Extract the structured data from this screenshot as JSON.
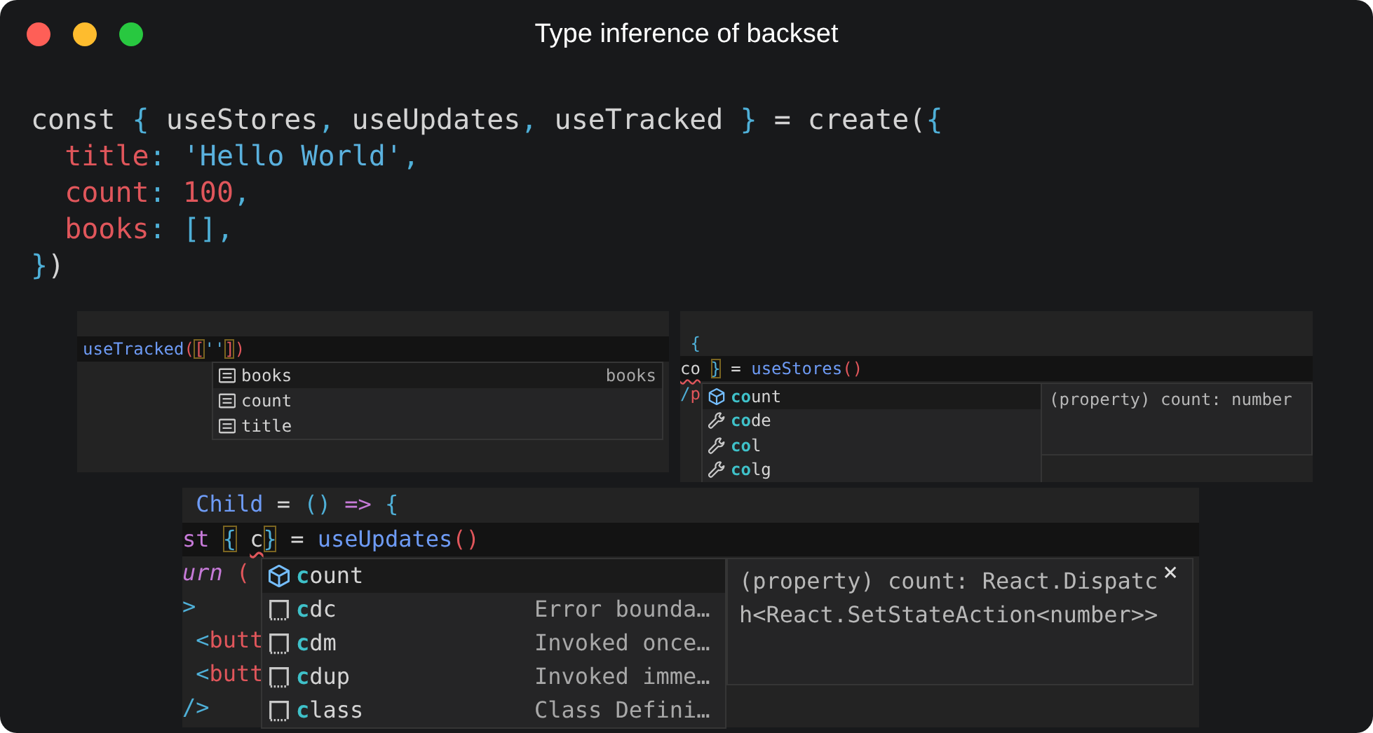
{
  "window": {
    "title": "Type inference of backset"
  },
  "code": {
    "lines": [
      [
        {
          "text": "const ",
          "kind": "plain"
        },
        {
          "text": "{",
          "kind": "brace"
        },
        {
          "text": " useStores",
          "kind": "plain"
        },
        {
          "text": ",",
          "kind": "brace"
        },
        {
          "text": " useUpdates",
          "kind": "plain"
        },
        {
          "text": ",",
          "kind": "brace"
        },
        {
          "text": " useTracked ",
          "kind": "plain"
        },
        {
          "text": "}",
          "kind": "brace"
        },
        {
          "text": " = create(",
          "kind": "plain"
        },
        {
          "text": "{",
          "kind": "brace"
        }
      ],
      [
        {
          "text": "title",
          "kind": "key",
          "indented": true
        },
        {
          "text": ": ",
          "kind": "brace"
        },
        {
          "text": "'Hello World'",
          "kind": "string"
        },
        {
          "text": ",",
          "kind": "brace"
        }
      ],
      [
        {
          "text": "count",
          "kind": "key",
          "indented": true
        },
        {
          "text": ": ",
          "kind": "brace"
        },
        {
          "text": "100",
          "kind": "number"
        },
        {
          "text": ",",
          "kind": "brace"
        }
      ],
      [
        {
          "text": "books",
          "kind": "key",
          "indented": true
        },
        {
          "text": ": ",
          "kind": "brace"
        },
        {
          "text": "[]",
          "kind": "brace"
        },
        {
          "text": ",",
          "kind": "brace"
        }
      ],
      [
        {
          "text": "}",
          "kind": "brace"
        },
        {
          "text": ")",
          "kind": "plain"
        }
      ]
    ]
  },
  "panels": [
    {
      "lines": [
        {
          "current": true,
          "tokens": [
            {
              "text": "useTracked",
              "kind": "func"
            },
            {
              "text": "(",
              "kind": "paren"
            },
            {
              "text": "[",
              "kind": "paren-match"
            },
            {
              "text": "''",
              "kind": "string"
            },
            {
              "text": "]",
              "kind": "paren-match"
            },
            {
              "text": ")",
              "kind": "paren"
            }
          ]
        }
      ],
      "suggestions": [
        {
          "label": "books",
          "kind": "text",
          "selected": true,
          "detail": "books"
        },
        {
          "label": "count",
          "kind": "text",
          "selected": false
        },
        {
          "label": "title",
          "kind": "text",
          "selected": false
        }
      ]
    },
    {
      "lines": [
        {
          "current": false,
          "tokens": [
            {
              "text": " {",
              "kind": "brace"
            }
          ]
        },
        {
          "current": true,
          "tokens": [
            {
              "text": "co",
              "kind": "error"
            },
            {
              "text": "}",
              "kind": "brace-match",
              "spaced": true
            },
            {
              "text": " = ",
              "kind": "plain"
            },
            {
              "text": "useStores",
              "kind": "func"
            },
            {
              "text": "()",
              "kind": "paren"
            }
          ]
        },
        {
          "current": false,
          "tokens": [
            {
              "text": "/",
              "kind": "brace"
            },
            {
              "text": "p",
              "kind": "tag"
            }
          ]
        }
      ],
      "suggestions": [
        {
          "label": "**co**unt",
          "kind": "property",
          "selected": true
        },
        {
          "label": "**co**de",
          "kind": "wrench",
          "selected": false
        },
        {
          "label": "**co**l",
          "kind": "wrench",
          "selected": false
        },
        {
          "label": "**co**lg",
          "kind": "wrench",
          "selected": false
        }
      ],
      "doc": {
        "text": "(property) count: number"
      }
    },
    {
      "lines": [
        {
          "current": false,
          "tokens": [
            {
              "text": " Child",
              "kind": "func"
            },
            {
              "text": " = ",
              "kind": "plain"
            },
            {
              "text": "()",
              "kind": "brace"
            },
            {
              "text": " => ",
              "kind": "keyword"
            },
            {
              "text": "{",
              "kind": "brace"
            }
          ]
        },
        {
          "current": true,
          "tokens": [
            {
              "text": "st",
              "kind": "keyword"
            },
            {
              "text": "{",
              "kind": "brace-match",
              "spaced": true
            },
            {
              "text": "c",
              "kind": "error",
              "spaced": true
            },
            {
              "text": "}",
              "kind": "brace-match"
            },
            {
              "text": " = ",
              "kind": "plain"
            },
            {
              "text": "useUpdates",
              "kind": "func"
            },
            {
              "text": "()",
              "kind": "paren"
            }
          ]
        },
        {
          "current": false,
          "tokens": [
            {
              "text": "urn",
              "kind": "keyword-italic"
            },
            {
              "text": " (",
              "kind": "paren"
            }
          ]
        },
        {
          "current": false,
          "tokens": [
            {
              "text": ">",
              "kind": "brace"
            }
          ]
        },
        {
          "current": false,
          "tokens": [
            {
              "text": " <",
              "kind": "brace"
            },
            {
              "text": "butt",
              "kind": "tag"
            }
          ]
        },
        {
          "current": false,
          "tokens": [
            {
              "text": " <",
              "kind": "brace"
            },
            {
              "text": "butt",
              "kind": "tag"
            }
          ]
        },
        {
          "current": false,
          "tokens": [
            {
              "text": "/>",
              "kind": "brace"
            }
          ]
        }
      ],
      "suggestions": [
        {
          "label": "**c**ount",
          "kind": "property",
          "selected": true
        },
        {
          "label": "**c**dc",
          "kind": "snippet",
          "selected": false,
          "detail": "Error bounda…"
        },
        {
          "label": "**c**dm",
          "kind": "snippet",
          "selected": false,
          "detail": "Invoked once…"
        },
        {
          "label": "**c**dup",
          "kind": "snippet",
          "selected": false,
          "detail": "Invoked imme…"
        },
        {
          "label": "**c**lass",
          "kind": "snippet",
          "selected": false,
          "detail": "Class Defini…"
        }
      ],
      "doc": {
        "text": "(property) count: React.Dispatch<React.SetStateAction<number>>",
        "close": "×"
      }
    }
  ]
}
